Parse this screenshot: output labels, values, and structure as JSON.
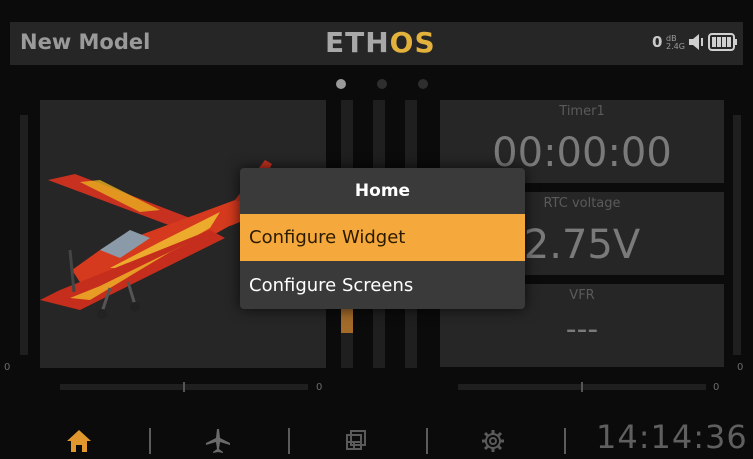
{
  "header": {
    "model_name": "New Model",
    "logo_main": "ETH",
    "logo_accent": "OS",
    "rssi_value": "0",
    "rssi_unit": "dB",
    "rssi_band": "2.4G",
    "accent_color": "#e2b23c"
  },
  "pager": {
    "total": 3,
    "active": 0
  },
  "widgets": {
    "timer": {
      "label": "Timer1",
      "value": "00:00:00"
    },
    "rtc": {
      "label": "RTC voltage",
      "value": "2.75V"
    },
    "vfr": {
      "label": "VFR",
      "value": "---"
    }
  },
  "trims": {
    "left_vertical_value": "0",
    "left_horizontal_value": "0",
    "right_horizontal_value": "0",
    "right_vertical_value": "0"
  },
  "bottom_bar": {
    "icons": [
      "home-icon",
      "airplane-icon",
      "screens-icon",
      "gear-icon"
    ],
    "clock": "14:14:36"
  },
  "dialog": {
    "title": "Home",
    "items": [
      {
        "label": "Configure Widget",
        "selected": true
      },
      {
        "label": "Configure Screens",
        "selected": false
      }
    ],
    "highlight_color": "#f5a83b"
  }
}
